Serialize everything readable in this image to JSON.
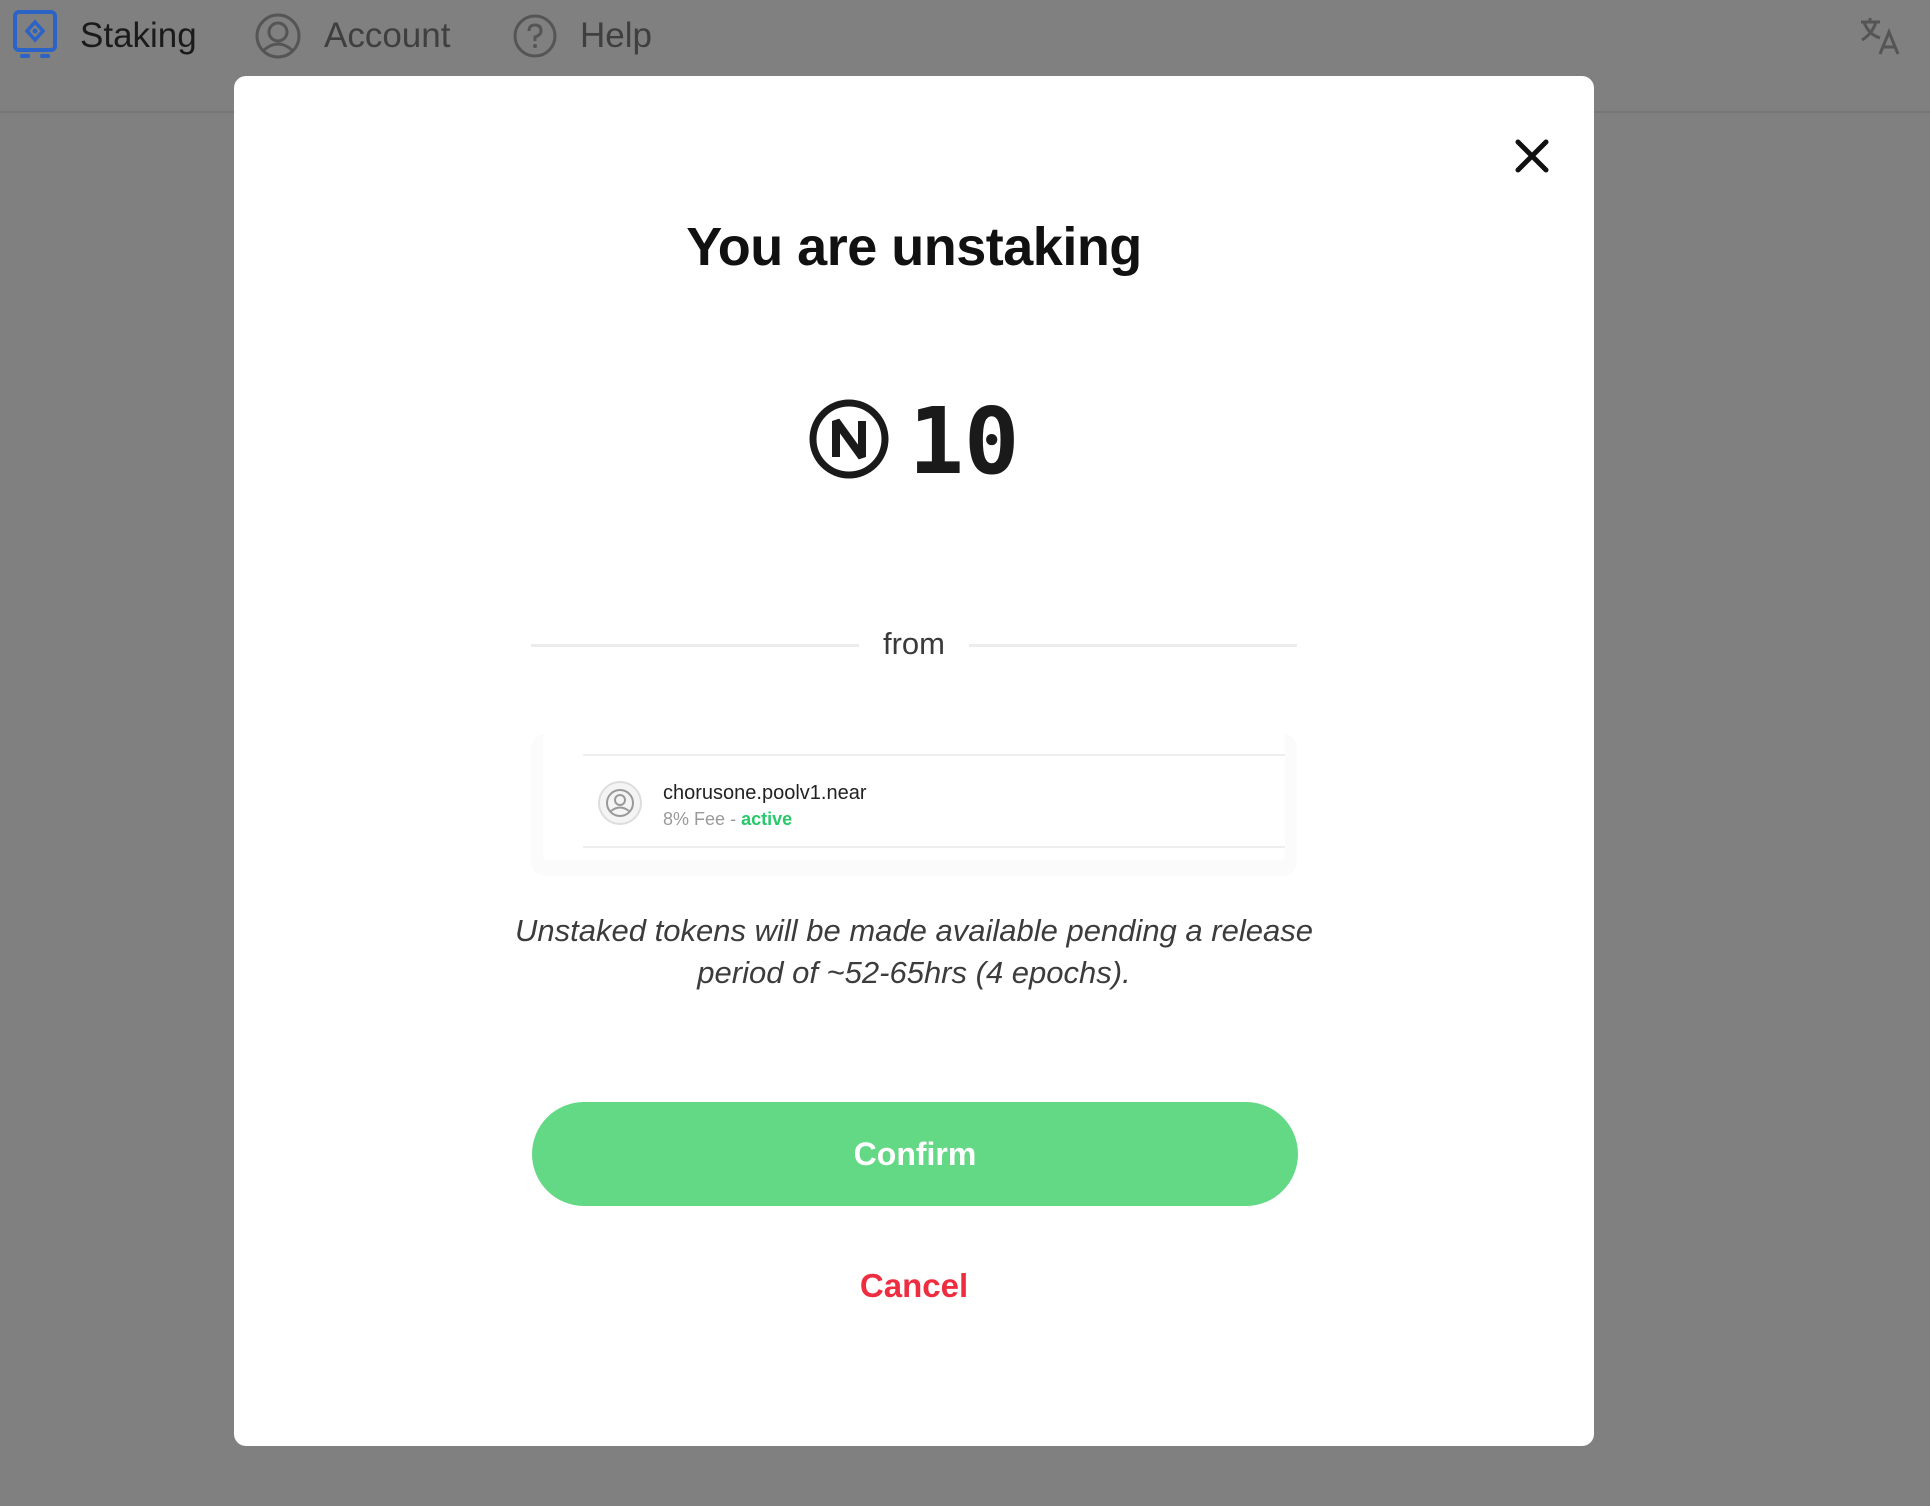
{
  "nav": {
    "items": [
      {
        "label": "Staking",
        "icon": "staking-icon"
      },
      {
        "label": "Account",
        "icon": "account-icon"
      },
      {
        "label": "Help",
        "icon": "help-icon"
      }
    ],
    "right_icon": "translate-icon"
  },
  "modal": {
    "title": "You are unstaking",
    "currency_symbol": "Ⓝ",
    "amount": "10",
    "from_label": "from",
    "validator": {
      "name": "chorusone.poolv1.near",
      "fee": "8% Fee",
      "separator": "-",
      "status": "active"
    },
    "notice": "Unstaked tokens will be made available pending a release period of ~52-65hrs (4 epochs).",
    "confirm_label": "Confirm",
    "cancel_label": "Cancel"
  },
  "colors": {
    "backdrop": "#808080",
    "confirm": "#63d885",
    "cancel": "#ee2d40",
    "status_active": "#27c96b",
    "nav_active_icon": "#2b63c6"
  }
}
